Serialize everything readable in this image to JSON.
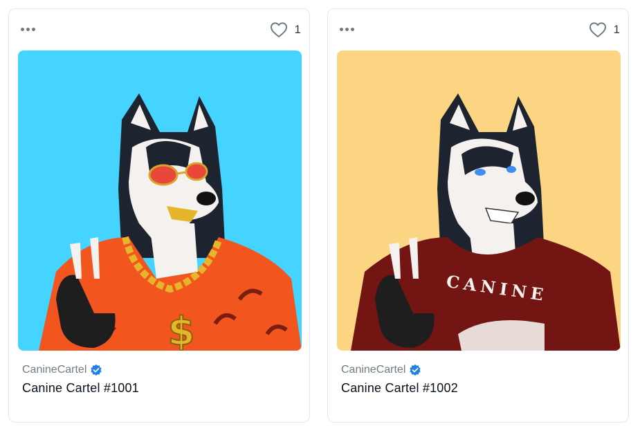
{
  "colors": {
    "card_border": "#e5e8eb",
    "verified_badge": "#2081e2",
    "heart_stroke": "#707a83",
    "art_bg_blue": "#45d3ff",
    "art_bg_yellow": "#fcd583",
    "shirt_orange": "#f2551d",
    "shirt_maroon": "#731513"
  },
  "cards": [
    {
      "more_icon": "more-horizontal-icon",
      "like_icon": "heart-outline-icon",
      "like_count": "1",
      "collection": "CanineCartel",
      "verified_icon": "verified-badge-icon",
      "name": "Canine Cartel #1001"
    },
    {
      "more_icon": "more-horizontal-icon",
      "like_icon": "heart-outline-icon",
      "like_count": "1",
      "collection": "CanineCartel",
      "verified_icon": "verified-badge-icon",
      "name": "Canine Cartel #1002",
      "shirt_text": "CANINE"
    }
  ]
}
